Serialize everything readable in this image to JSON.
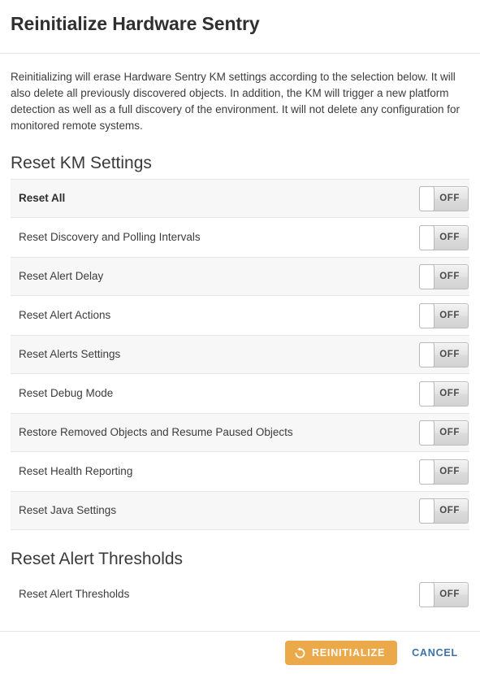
{
  "dialog": {
    "title": "Reinitialize Hardware Sentry",
    "description": "Reinitializing will erase Hardware Sentry KM settings according to the selection below. It will also delete all previously discovered objects. In addition, the KM will trigger a new platform detection as well as a full discovery of the environment. It will not delete any configuration for monitored remote systems."
  },
  "sections": [
    {
      "heading": "Reset KM Settings",
      "rows": [
        {
          "label": "Reset All",
          "state": "OFF",
          "bold": true
        },
        {
          "label": "Reset Discovery and Polling Intervals",
          "state": "OFF",
          "bold": false
        },
        {
          "label": "Reset Alert Delay",
          "state": "OFF",
          "bold": false
        },
        {
          "label": "Reset Alert Actions",
          "state": "OFF",
          "bold": false
        },
        {
          "label": "Reset Alerts Settings",
          "state": "OFF",
          "bold": false
        },
        {
          "label": "Reset Debug Mode",
          "state": "OFF",
          "bold": false
        },
        {
          "label": "Restore Removed Objects and Resume Paused Objects",
          "state": "OFF",
          "bold": false
        },
        {
          "label": "Reset Health Reporting",
          "state": "OFF",
          "bold": false
        },
        {
          "label": "Reset Java Settings",
          "state": "OFF",
          "bold": false
        }
      ]
    },
    {
      "heading": "Reset Alert Thresholds",
      "rows": [
        {
          "label": "Reset Alert Thresholds",
          "state": "OFF",
          "bold": false
        }
      ]
    }
  ],
  "footer": {
    "primary_label": "REINITIALIZE",
    "primary_icon": "rotate-left-icon",
    "cancel_label": "CANCEL"
  },
  "colors": {
    "primary": "#eca94a",
    "link": "#3b72ab",
    "row_stripe": "#f7f7f7",
    "border": "#e4e4e4"
  }
}
